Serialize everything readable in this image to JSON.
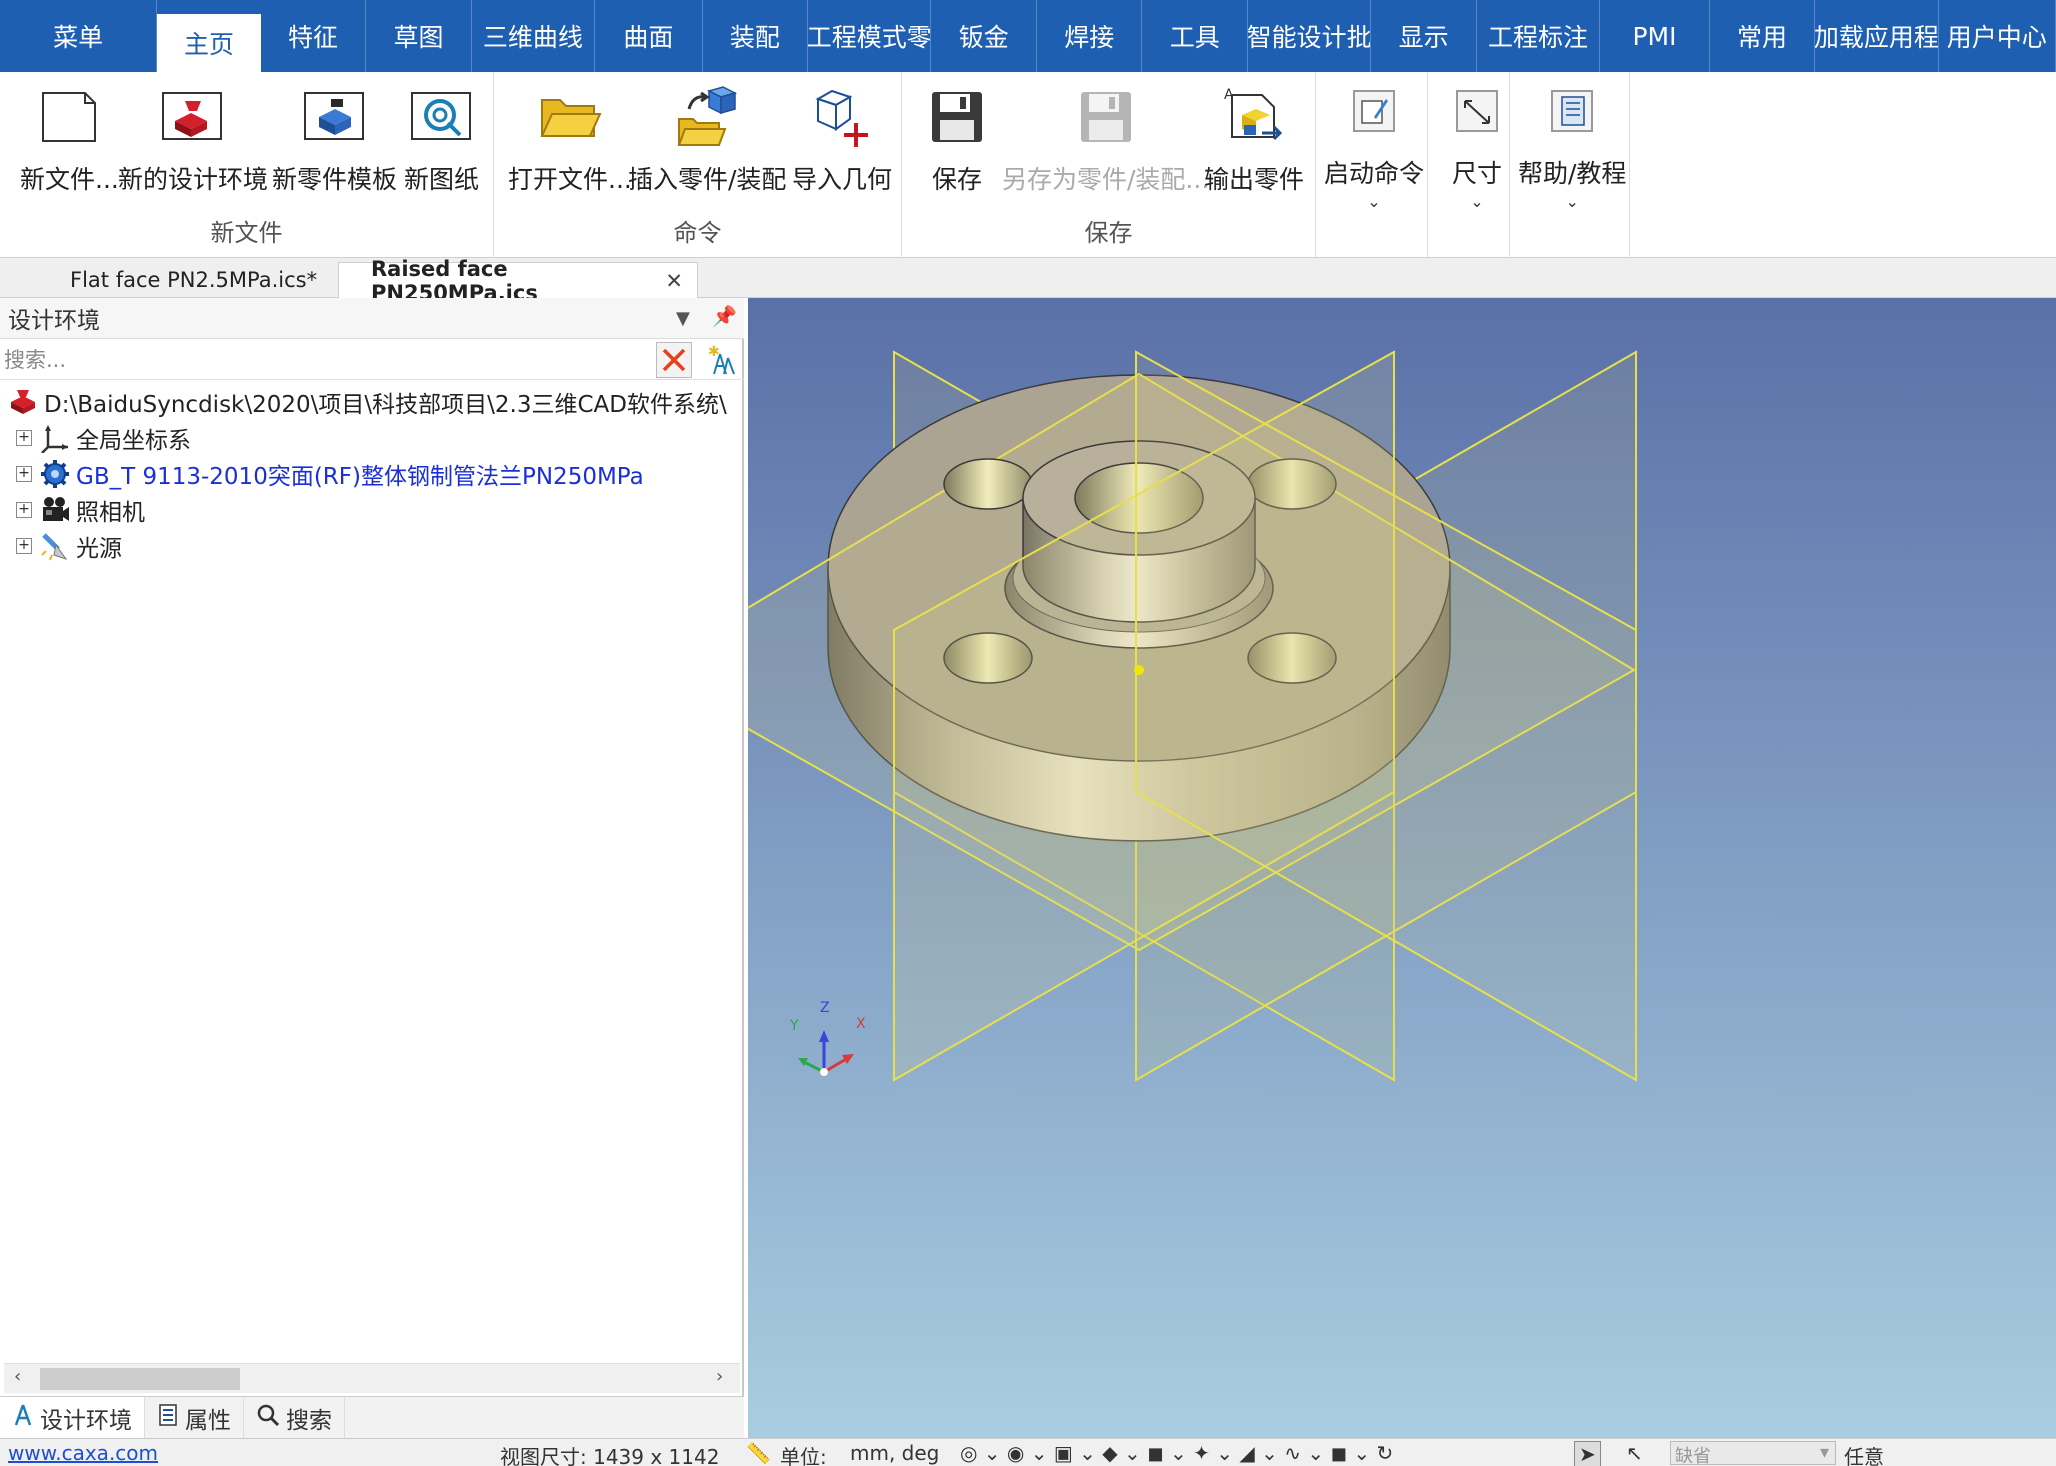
{
  "menubar": {
    "tabs": [
      {
        "label": "菜单",
        "active": false
      },
      {
        "label": "主页",
        "active": true
      },
      {
        "label": "特征",
        "active": false
      },
      {
        "label": "草图",
        "active": false
      },
      {
        "label": "三维曲线",
        "active": false
      },
      {
        "label": "曲面",
        "active": false
      },
      {
        "label": "装配",
        "active": false
      },
      {
        "label": "工程模式零",
        "active": false
      },
      {
        "label": "钣金",
        "active": false
      },
      {
        "label": "焊接",
        "active": false
      },
      {
        "label": "工具",
        "active": false
      },
      {
        "label": "智能设计批",
        "active": false
      },
      {
        "label": "显示",
        "active": false
      },
      {
        "label": "工程标注",
        "active": false
      },
      {
        "label": "PMI",
        "active": false
      },
      {
        "label": "常用",
        "active": false
      },
      {
        "label": "加载应用程",
        "active": false
      },
      {
        "label": "用户中心",
        "active": false
      }
    ]
  },
  "ribbon": {
    "new_file": {
      "group_label": "新文件",
      "new_file_label": "新文件...",
      "new_design_env_label": "新的设计环境",
      "new_part_template_label": "新零件模板",
      "new_drawing_label": "新图纸"
    },
    "command": {
      "group_label": "命令",
      "open_file_label": "打开文件...",
      "insert_part_label": "插入零件/装配",
      "import_geometry_label": "导入几何"
    },
    "save": {
      "group_label": "保存",
      "save_label": "保存",
      "save_as_label": "另存为零件/装配...",
      "export_part_label": "输出零件"
    },
    "launch_command_label": "启动命令",
    "dimension_label": "尺寸",
    "help_label": "帮助/教程"
  },
  "doc_tabs": {
    "tab1": "Flat face PN2.5MPa.ics*",
    "tab2": "Raised face PN250MPa.ics",
    "close_glyph": "✕"
  },
  "panel": {
    "title": "设计环境",
    "search_placeholder": "搜索...",
    "tree": {
      "root": "D:\\BaiduSyncdisk\\2020\\项目\\科技部项目\\2.3三维CAD软件系统\\",
      "items": [
        {
          "label": "全局坐标系",
          "icon": "coordinate-system-icon"
        },
        {
          "label": "GB_T 9113-2010突面(RF)整体钢制管法兰PN250MPa",
          "icon": "part-gear-icon"
        },
        {
          "label": "照相机",
          "icon": "camera-icon"
        },
        {
          "label": "光源",
          "icon": "light-source-icon"
        }
      ]
    },
    "bottom_tabs": {
      "design_env": "设计环境",
      "properties": "属性",
      "search": "搜索"
    }
  },
  "viewport": {
    "axis_z": "Z",
    "axis_x": "X",
    "axis_y": "Y"
  },
  "statusbar": {
    "website": "www.caxa.com",
    "view_size": "视图尺寸: 1439 x 1142",
    "units_label": "单位:",
    "units_value": "mm, deg",
    "combo_default": "缺省",
    "any_label": "任意"
  },
  "colors": {
    "menubar_bg": "#1f5fb2",
    "viewport_top": "#5a70a8",
    "viewport_bottom": "#a9cde0",
    "part_face": "#aca493",
    "plane_line": "#e8e04a"
  }
}
